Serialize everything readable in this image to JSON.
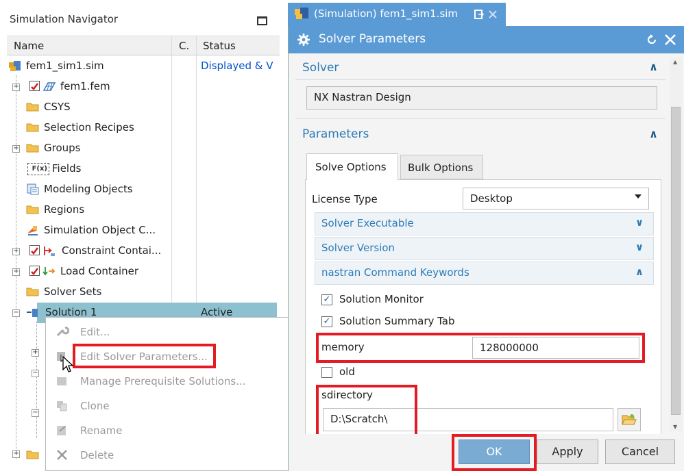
{
  "navigator": {
    "title": "Simulation Navigator",
    "columns": {
      "name": "Name",
      "check": "C.",
      "status": "Status"
    },
    "items": [
      {
        "label": "fem1_sim1.sim",
        "status": "Displayed & V"
      },
      {
        "label": "fem1.fem",
        "status": ""
      },
      {
        "label": "CSYS",
        "status": ""
      },
      {
        "label": "Selection Recipes",
        "status": ""
      },
      {
        "label": "Groups",
        "status": ""
      },
      {
        "label": "Fields",
        "fx_text": "F(x)",
        "status": ""
      },
      {
        "label": "Modeling Objects",
        "status": ""
      },
      {
        "label": "Regions",
        "status": ""
      },
      {
        "label": "Simulation Object C...",
        "status": ""
      },
      {
        "label": "Constraint Contai...",
        "status": ""
      },
      {
        "label": "Load Container",
        "status": ""
      },
      {
        "label": "Solver Sets",
        "status": ""
      },
      {
        "label": "Solution 1",
        "status": "Active"
      }
    ]
  },
  "context_menu": {
    "items": [
      {
        "label": "Edit...",
        "icon": "wrench-icon"
      },
      {
        "label": "Edit Solver Parameters...",
        "icon": "solver-edit-icon"
      },
      {
        "label": "Manage Prerequisite Solutions...",
        "icon": "prerequisite-icon"
      },
      {
        "label": "Clone",
        "icon": "clone-icon"
      },
      {
        "label": "Rename",
        "icon": "rename-icon"
      },
      {
        "label": "Delete",
        "icon": "delete-icon"
      }
    ]
  },
  "doc_tab": {
    "label": "(Simulation) fem1_sim1.sim"
  },
  "dialog": {
    "title": "Solver Parameters",
    "solver_section": {
      "title": "Solver",
      "value": "NX Nastran Design"
    },
    "parameters_section": {
      "title": "Parameters",
      "tabs": [
        "Solve Options",
        "Bulk Options"
      ],
      "license_type_label": "License Type",
      "license_type_value": "Desktop",
      "subsections": [
        "Solver Executable",
        "Solver Version",
        "nastran Command Keywords"
      ],
      "solution_monitor": "Solution Monitor",
      "solution_summary_tab": "Solution Summary Tab",
      "memory_label": "memory",
      "memory_value": "128000000",
      "old_label": "old",
      "sdirectory_label": "sdirectory",
      "sdirectory_value": "D:\\Scratch\\"
    },
    "buttons": {
      "ok": "OK",
      "apply": "Apply",
      "cancel": "Cancel"
    }
  },
  "colors": {
    "accent": "#5b9bd5",
    "highlight": "#e31b23",
    "selected_row": "#8ec1d0",
    "link": "#0050c8"
  }
}
